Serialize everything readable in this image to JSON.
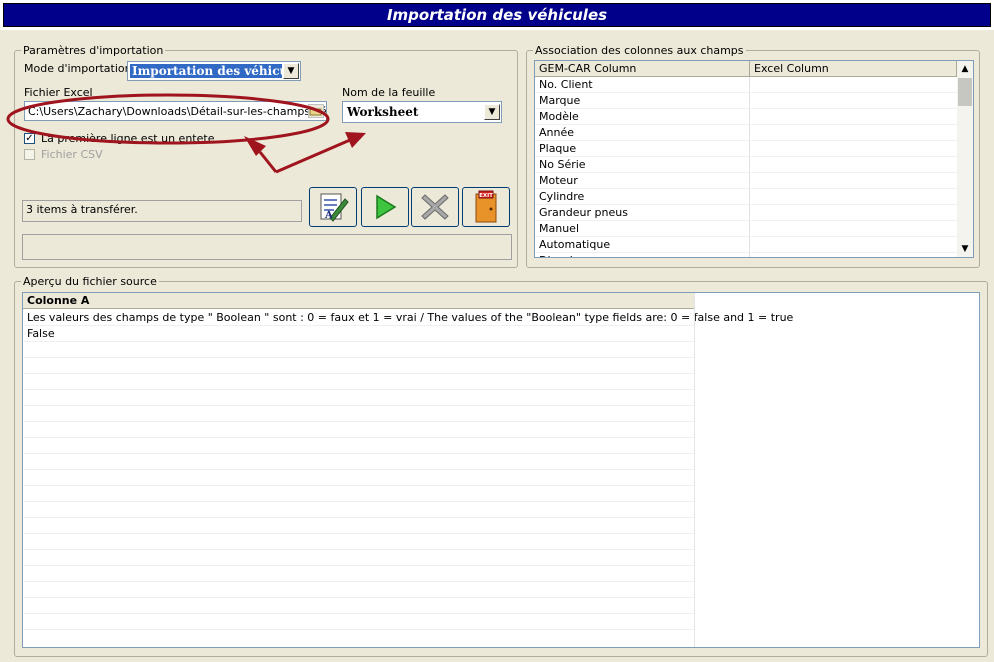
{
  "window": {
    "title": "Importation des véhicules"
  },
  "import_params": {
    "legend": "Paramètres d'importation",
    "mode_label": "Mode d'importation",
    "mode_value": "Importation des véhicules",
    "excel_label": "Fichier Excel",
    "excel_path": "C:\\Users\\Zachary\\Downloads\\Détail-sur-les-champs-véhi",
    "sheet_label": "Nom de la feuille",
    "sheet_value": "Worksheet",
    "first_row_header_label": "La première ligne est un entete",
    "first_row_header_checked": true,
    "csv_label": "Fichier CSV",
    "csv_checked": false,
    "status_text": "3 items à transférer.",
    "progress_text": ""
  },
  "toolbar": {
    "buttons": [
      {
        "name": "edit-mapping-icon"
      },
      {
        "name": "run-import-icon"
      },
      {
        "name": "cancel-icon"
      },
      {
        "name": "exit-icon",
        "label": "EXIT"
      }
    ]
  },
  "mapping": {
    "legend": "Association des colonnes aux champs",
    "columns": [
      "GEM-CAR Column",
      "Excel Column"
    ],
    "rows": [
      "No. Client",
      "Marque",
      "Modèle",
      "Année",
      "Plaque",
      "No Série",
      "Moteur",
      "Cylindre",
      "Grandeur pneus",
      "Manuel",
      "Automatique",
      "Diesel"
    ]
  },
  "preview": {
    "legend": "Aperçu du fichier source",
    "column_header": "Colonne A",
    "rows": [
      "Les valeurs des champs de type \" Boolean \" sont : 0 = faux et 1 = vrai /  The values of the \"Boolean\" type fields are: 0 = false and 1 = true",
      "False"
    ]
  },
  "colors": {
    "title_bar": "#00008b",
    "annotation": "#a0141e",
    "selection": "#316ac5"
  }
}
